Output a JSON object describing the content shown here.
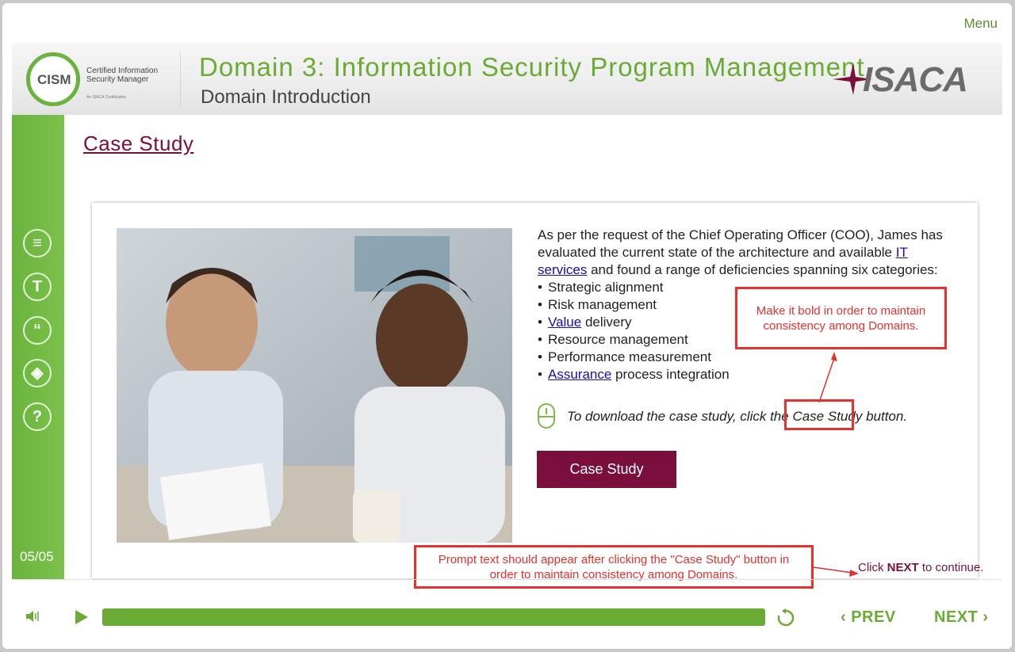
{
  "menu_label": "Menu",
  "header": {
    "logo_abbrev": "CISM",
    "logo_line1": "Certified Information",
    "logo_line2": "Security Manager",
    "logo_sub": "An ISACA Certification",
    "title": "Domain 3: Information Security Program Management",
    "subtitle": "Domain Introduction",
    "brand": "ISACA"
  },
  "sidebar": {
    "icons": [
      {
        "name": "notes-icon",
        "glyph": "≡"
      },
      {
        "name": "transcript-icon",
        "glyph": "T"
      },
      {
        "name": "quote-icon",
        "glyph": "“"
      },
      {
        "name": "layers-icon",
        "glyph": "◈"
      },
      {
        "name": "help-icon",
        "glyph": "?"
      }
    ],
    "page_count": "05/05"
  },
  "main": {
    "title": "Case Study",
    "intro_1": "As per the request of the Chief Operating Officer (COO), James has evaluated the current state of the architecture and available ",
    "intro_link": "IT services",
    "intro_2": " and found a range of deficiencies spanning six categories:",
    "bullets": {
      "b1": "Strategic alignment",
      "b2": "Risk management",
      "b3_link": "Value",
      "b3_rest": " delivery",
      "b4": "Resource management",
      "b5": "Performance measurement",
      "b6_link": "Assurance",
      "b6_rest": " process integration"
    },
    "prompt_pre": "To download the case study, click the ",
    "prompt_highlight": "Case Study",
    "prompt_post": " button.",
    "button_label": "Case Study"
  },
  "annotations": {
    "bold_note": "Make it bold in order to maintain consistency among Domains.",
    "prompt_note": "Prompt text should appear after clicking the \"Case Study\" button in order to maintain consistency among Domains."
  },
  "footer": {
    "click_pre": "Click ",
    "click_bold": "NEXT",
    "click_post": " to continue.",
    "prev_label": "PREV",
    "next_label": "NEXT",
    "progress_fraction": 1.0
  },
  "colors": {
    "accent_green": "#6aab35",
    "maroon": "#7a0f3b",
    "annotation_red": "#e8302d",
    "link_blue": "#1a0dab"
  }
}
